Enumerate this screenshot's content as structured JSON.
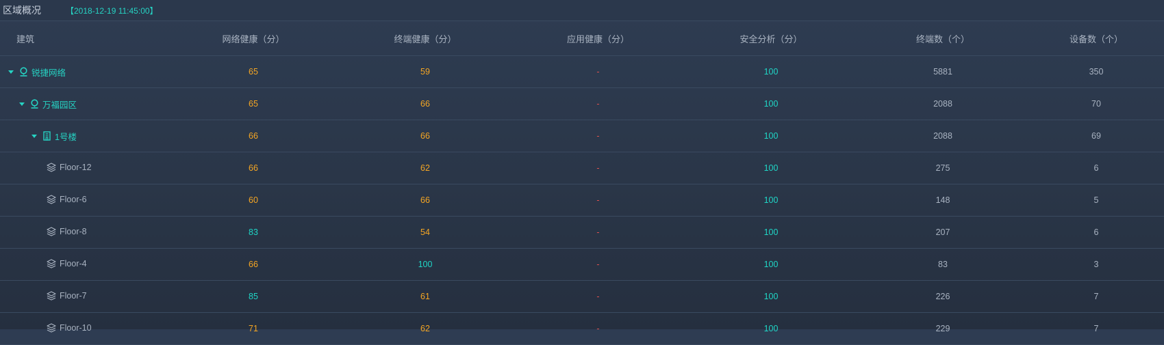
{
  "header": {
    "title": "区域概况",
    "timestamp": "【2018-12-19 11:45:00】"
  },
  "table": {
    "columns": [
      "建筑",
      "网络健康（分）",
      "终端健康（分）",
      "应用健康（分）",
      "安全分析（分）",
      "终端数（个）",
      "设备数（个）"
    ],
    "rows": [
      {
        "name": "锐捷网络",
        "level": 0,
        "icon": "location-pin-icon",
        "expandable": true,
        "network": "65",
        "terminal_health": "59",
        "app": "-",
        "security": "100",
        "terminals": "5881",
        "devices": "350"
      },
      {
        "name": "万福园区",
        "level": 1,
        "icon": "location-pin-icon",
        "expandable": true,
        "network": "65",
        "terminal_health": "66",
        "app": "-",
        "security": "100",
        "terminals": "2088",
        "devices": "70"
      },
      {
        "name": "1号楼",
        "level": 2,
        "icon": "building-icon",
        "expandable": true,
        "network": "66",
        "terminal_health": "66",
        "app": "-",
        "security": "100",
        "terminals": "2088",
        "devices": "69"
      },
      {
        "name": "Floor-12",
        "level": 3,
        "icon": "layers-icon",
        "expandable": false,
        "network": "66",
        "terminal_health": "62",
        "app": "-",
        "security": "100",
        "terminals": "275",
        "devices": "6"
      },
      {
        "name": "Floor-6",
        "level": 3,
        "icon": "layers-icon",
        "expandable": false,
        "network": "60",
        "terminal_health": "66",
        "app": "-",
        "security": "100",
        "terminals": "148",
        "devices": "5"
      },
      {
        "name": "Floor-8",
        "level": 3,
        "icon": "layers-icon",
        "expandable": false,
        "network": "83",
        "terminal_health": "54",
        "app": "-",
        "security": "100",
        "terminals": "207",
        "devices": "6"
      },
      {
        "name": "Floor-4",
        "level": 3,
        "icon": "layers-icon",
        "expandable": false,
        "network": "66",
        "terminal_health": "100",
        "app": "-",
        "security": "100",
        "terminals": "83",
        "devices": "3"
      },
      {
        "name": "Floor-7",
        "level": 3,
        "icon": "layers-icon",
        "expandable": false,
        "network": "85",
        "terminal_health": "61",
        "app": "-",
        "security": "100",
        "terminals": "226",
        "devices": "7"
      },
      {
        "name": "Floor-10",
        "level": 3,
        "icon": "layers-icon",
        "expandable": false,
        "network": "71",
        "terminal_health": "62",
        "app": "-",
        "security": "100",
        "terminals": "229",
        "devices": "7"
      }
    ]
  },
  "colors": {
    "accent_teal": "#26d3c3",
    "warning_orange": "#f5a623",
    "na_red": "#e0524f",
    "text_gray": "#a9b3c1",
    "background": "#2a3648"
  }
}
